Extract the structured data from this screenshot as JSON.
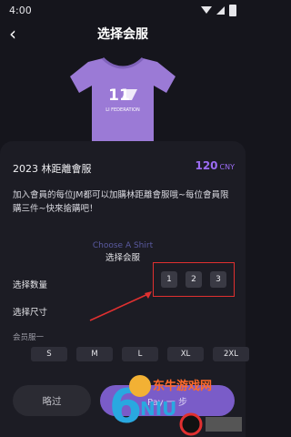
{
  "status_bar": {
    "time": "4:00"
  },
  "nav": {
    "title": "选择会服"
  },
  "product": {
    "name": "2023 林距離會服",
    "price": "120",
    "currency": "CNY",
    "description": "加入會員的每位JM都可以加購林距離會服哦~每位會員限購三件~快來搶購吧！",
    "shirt_print": "11",
    "shirt_text": "LI FEDERATION"
  },
  "overlay": {
    "ghost_text": "Choose A Shirt",
    "title": "选择会服"
  },
  "quantity": {
    "label": "选择数量",
    "options": [
      "1",
      "2",
      "3"
    ]
  },
  "size": {
    "label": "选择尺寸",
    "header": "会员服一",
    "options": [
      "S",
      "M",
      "L",
      "XL",
      "2XL"
    ]
  },
  "footer": {
    "skip_label": "略过",
    "pay_label": "Pay 一 步"
  },
  "colors": {
    "accent": "#9b6cf2",
    "background": "#15151c",
    "sheet": "#1c1c24",
    "highlight": "#e03030",
    "shirt": "#9b7ad6"
  },
  "watermark": {
    "brand": "东牛游戏网",
    "sub": "6NIU.COM"
  }
}
